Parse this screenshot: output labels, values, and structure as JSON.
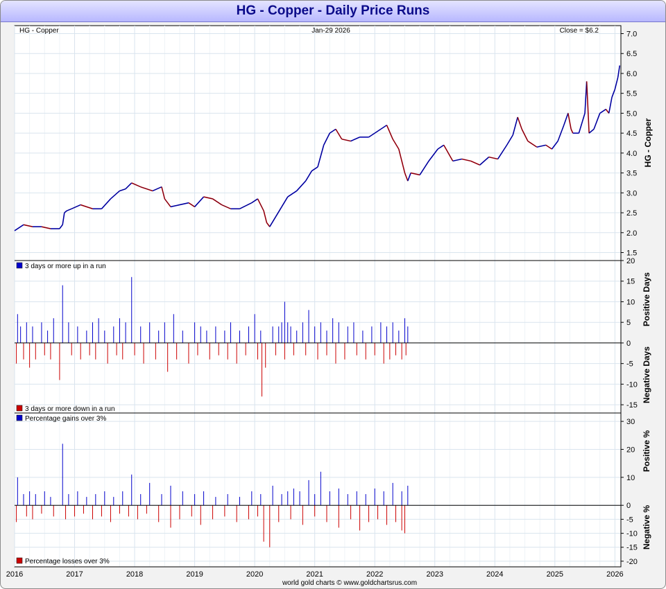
{
  "title": "HG  -  Copper - Daily Price Runs",
  "footer": "world gold charts © www.goldchartsrus.com",
  "colors": {
    "up": "#0000cc",
    "down": "#cc0000",
    "price": "#000033",
    "grid": "#d9e4ee",
    "title": "#0a0a8a"
  },
  "chart_data": [
    {
      "type": "line",
      "header_left": "HG  -  Copper",
      "header_center": "Jan-29  2026",
      "header_right": "Close = $6.2",
      "ylabel": "HG  -  Copper",
      "ylim": [
        1.3,
        7.2
      ],
      "yticks": [
        1.5,
        2.0,
        2.5,
        3.0,
        3.5,
        4.0,
        4.5,
        5.0,
        5.5,
        6.0,
        6.5,
        7.0
      ],
      "xlim": [
        2016.0,
        2026.1
      ],
      "xticks": [
        2016,
        2017,
        2018,
        2019,
        2020,
        2021,
        2022,
        2023,
        2024,
        2025,
        2026
      ],
      "series": [
        {
          "x": [
            2016.0,
            2016.15,
            2016.3,
            2016.45,
            2016.6,
            2016.75,
            2016.8,
            2016.83,
            2016.87,
            2016.95,
            2017.1,
            2017.3,
            2017.45,
            2017.6,
            2017.75,
            2017.85,
            2017.95,
            2018.1,
            2018.3,
            2018.45,
            2018.5,
            2018.6,
            2018.75,
            2018.9,
            2019.0,
            2019.15,
            2019.3,
            2019.45,
            2019.6,
            2019.75,
            2019.95,
            2020.05,
            2020.15,
            2020.2,
            2020.25,
            2020.35,
            2020.45,
            2020.55,
            2020.7,
            2020.85,
            2020.95,
            2021.05,
            2021.15,
            2021.25,
            2021.35,
            2021.45,
            2021.6,
            2021.75,
            2021.9,
            2022.0,
            2022.1,
            2022.2,
            2022.3,
            2022.4,
            2022.5,
            2022.55,
            2022.6,
            2022.75,
            2022.9,
            2023.05,
            2023.15,
            2023.3,
            2023.45,
            2023.6,
            2023.75,
            2023.9,
            2024.05,
            2024.2,
            2024.3,
            2024.38,
            2024.45,
            2024.55,
            2024.7,
            2024.85,
            2024.95,
            2025.05,
            2025.15,
            2025.22,
            2025.27,
            2025.3,
            2025.4,
            2025.5,
            2025.53,
            2025.57,
            2025.65,
            2025.75,
            2025.85,
            2025.9,
            2025.95,
            2026.0,
            2026.05,
            2026.08
          ],
          "y": [
            2.05,
            2.2,
            2.15,
            2.15,
            2.1,
            2.1,
            2.2,
            2.5,
            2.55,
            2.6,
            2.7,
            2.6,
            2.6,
            2.85,
            3.05,
            3.1,
            3.25,
            3.15,
            3.05,
            3.15,
            2.85,
            2.65,
            2.7,
            2.75,
            2.65,
            2.9,
            2.85,
            2.7,
            2.6,
            2.6,
            2.75,
            2.85,
            2.55,
            2.25,
            2.15,
            2.4,
            2.65,
            2.9,
            3.05,
            3.3,
            3.55,
            3.65,
            4.2,
            4.5,
            4.6,
            4.35,
            4.3,
            4.4,
            4.4,
            4.5,
            4.6,
            4.7,
            4.35,
            4.1,
            3.5,
            3.3,
            3.5,
            3.45,
            3.8,
            4.1,
            4.2,
            3.8,
            3.85,
            3.8,
            3.7,
            3.9,
            3.85,
            4.2,
            4.45,
            4.9,
            4.6,
            4.3,
            4.15,
            4.2,
            4.1,
            4.3,
            4.7,
            5.0,
            4.6,
            4.5,
            4.5,
            5.0,
            5.8,
            4.5,
            4.6,
            5.0,
            5.1,
            5.0,
            5.4,
            5.6,
            5.9,
            6.2
          ]
        }
      ]
    },
    {
      "type": "bar",
      "legend_top": "3 days or more up in a run",
      "legend_bottom": "3 days or more down in a run",
      "ylabel_top": "Positive Days",
      "ylabel_bottom": "Negative Days",
      "ylim": [
        -17,
        20
      ],
      "yticks": [
        20,
        15,
        10,
        5,
        0,
        -5,
        -10,
        -15
      ],
      "series": [
        {
          "name": "3 days or more up in a run",
          "x": [
            2016.05,
            2016.1,
            2016.2,
            2016.3,
            2016.45,
            2016.55,
            2016.65,
            2016.8,
            2016.9,
            2017.05,
            2017.2,
            2017.3,
            2017.4,
            2017.5,
            2017.65,
            2017.75,
            2017.85,
            2017.95,
            2018.1,
            2018.25,
            2018.4,
            2018.5,
            2018.65,
            2018.8,
            2019.0,
            2019.1,
            2019.2,
            2019.35,
            2019.5,
            2019.6,
            2019.75,
            2019.9,
            2020.0,
            2020.1,
            2020.3,
            2020.4,
            2020.45,
            2020.5,
            2020.55,
            2020.6,
            2020.7,
            2020.8,
            2020.9,
            2021.0,
            2021.1,
            2021.2,
            2021.3,
            2021.4,
            2021.55,
            2021.65,
            2021.8,
            2021.95,
            2022.1,
            2022.2,
            2022.3,
            2022.4,
            2022.5,
            2022.55
          ],
          "values": [
            7,
            4,
            5,
            4,
            5,
            3,
            6,
            14,
            5,
            4,
            3,
            5,
            6,
            3,
            4,
            6,
            5,
            16,
            4,
            5,
            3,
            5,
            7,
            3,
            5,
            4,
            3,
            4,
            3,
            5,
            3,
            4,
            7,
            3,
            4,
            4,
            5,
            10,
            5,
            4,
            3,
            5,
            8,
            4,
            5,
            3,
            6,
            5,
            4,
            5,
            3,
            4,
            5,
            4,
            5,
            3,
            6,
            4
          ]
        },
        {
          "name": "3 days or more down in a run",
          "x": [
            2016.03,
            2016.15,
            2016.25,
            2016.35,
            2016.5,
            2016.6,
            2016.75,
            2016.95,
            2017.1,
            2017.25,
            2017.35,
            2017.55,
            2017.7,
            2017.8,
            2018.0,
            2018.15,
            2018.35,
            2018.55,
            2018.7,
            2018.9,
            2019.05,
            2019.25,
            2019.4,
            2019.55,
            2019.7,
            2019.85,
            2020.05,
            2020.12,
            2020.18,
            2020.35,
            2020.5,
            2020.65,
            2020.85,
            2021.05,
            2021.2,
            2021.35,
            2021.5,
            2021.7,
            2021.85,
            2022.0,
            2022.15,
            2022.25,
            2022.35,
            2022.45,
            2022.52
          ],
          "values": [
            -5,
            -4,
            -6,
            -4,
            -3,
            -4,
            -9,
            -3,
            -4,
            -3,
            -4,
            -5,
            -3,
            -4,
            -3,
            -5,
            -4,
            -7,
            -4,
            -5,
            -3,
            -4,
            -3,
            -4,
            -5,
            -3,
            -4,
            -13,
            -6,
            -3,
            -4,
            -3,
            -3,
            -4,
            -3,
            -5,
            -4,
            -3,
            -4,
            -3,
            -5,
            -4,
            -3,
            -4,
            -3
          ]
        }
      ]
    },
    {
      "type": "bar",
      "legend_top": "Percentage gains over 3%",
      "legend_bottom": "Percentage losses over 3%",
      "ylabel_top": "Positive %",
      "ylabel_bottom": "Negative %",
      "ylim": [
        -22,
        33
      ],
      "yticks": [
        30,
        20,
        10,
        0,
        -5,
        -10,
        -15,
        -20
      ],
      "series": [
        {
          "name": "Percentage gains over 3%",
          "x": [
            2016.05,
            2016.15,
            2016.25,
            2016.35,
            2016.5,
            2016.6,
            2016.8,
            2016.9,
            2017.05,
            2017.2,
            2017.35,
            2017.5,
            2017.65,
            2017.8,
            2017.95,
            2018.1,
            2018.25,
            2018.45,
            2018.6,
            2018.8,
            2019.0,
            2019.15,
            2019.35,
            2019.55,
            2019.75,
            2019.95,
            2020.1,
            2020.3,
            2020.45,
            2020.55,
            2020.65,
            2020.75,
            2020.9,
            2021.0,
            2021.1,
            2021.25,
            2021.4,
            2021.55,
            2021.7,
            2021.85,
            2022.0,
            2022.15,
            2022.3,
            2022.45,
            2022.55
          ],
          "values": [
            10,
            4,
            5,
            4,
            5,
            3,
            22,
            4,
            5,
            3,
            4,
            5,
            3,
            5,
            11,
            4,
            8,
            4,
            7,
            5,
            4,
            5,
            3,
            4,
            3,
            5,
            4,
            7,
            4,
            5,
            6,
            5,
            9,
            4,
            12,
            5,
            6,
            4,
            5,
            4,
            6,
            5,
            8,
            5,
            7
          ]
        },
        {
          "name": "Percentage losses over 3%",
          "x": [
            2016.03,
            2016.2,
            2016.3,
            2016.45,
            2016.65,
            2016.85,
            2017.0,
            2017.15,
            2017.3,
            2017.45,
            2017.6,
            2017.75,
            2017.9,
            2018.05,
            2018.2,
            2018.4,
            2018.6,
            2018.75,
            2018.95,
            2019.1,
            2019.3,
            2019.5,
            2019.7,
            2019.9,
            2020.05,
            2020.15,
            2020.25,
            2020.4,
            2020.6,
            2020.8,
            2021.0,
            2021.2,
            2021.4,
            2021.6,
            2021.75,
            2021.9,
            2022.05,
            2022.2,
            2022.35,
            2022.45,
            2022.5
          ],
          "values": [
            -6,
            -4,
            -5,
            -3,
            -4,
            -5,
            -4,
            -3,
            -5,
            -4,
            -6,
            -3,
            -4,
            -5,
            -3,
            -6,
            -8,
            -5,
            -4,
            -7,
            -5,
            -4,
            -6,
            -5,
            -4,
            -13,
            -15,
            -6,
            -5,
            -7,
            -4,
            -6,
            -8,
            -5,
            -9,
            -6,
            -5,
            -7,
            -6,
            -9,
            -10
          ]
        }
      ]
    }
  ]
}
